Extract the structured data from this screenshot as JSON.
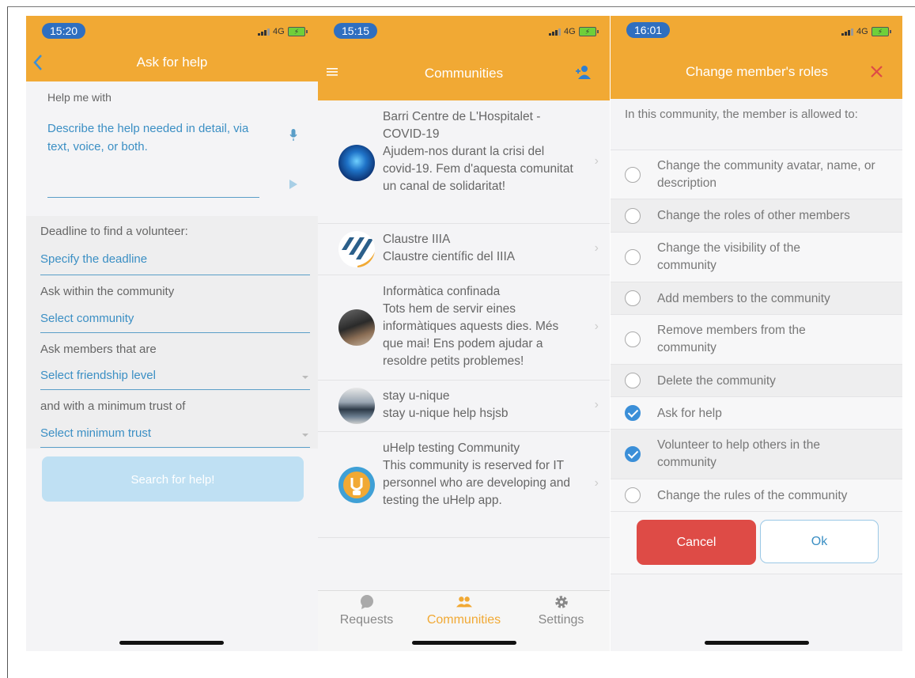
{
  "phone1": {
    "time": "15:20",
    "network": "4G",
    "title": "Ask for help",
    "help_label": "Help me with",
    "help_placeholder": "Describe the help needed in detail, via text, voice, or both.",
    "deadline_label": "Deadline to find a volunteer:",
    "deadline_value": "Specify the deadline",
    "community_label": "Ask within the community",
    "community_value": "Select community",
    "friendship_label": "Ask members that are",
    "friendship_value": "Select friendship level",
    "trust_label": "and with a minimum trust of",
    "trust_value": "Select minimum trust",
    "search_button": "Search for help!"
  },
  "phone2": {
    "time": "15:15",
    "network": "4G",
    "title": "Communities",
    "communities": [
      {
        "name": "Barri Centre de L'Hospitalet - COVID-19",
        "description": "Ajudem-nos durant la crisi del covid-19. Fem d'aquesta comunitat un canal de solidaritat!"
      },
      {
        "name": "Claustre IIIA",
        "description": "Claustre científic del IIIA"
      },
      {
        "name": "Informàtica confinada",
        "description": "Tots hem de servir eines informàtiques aquests dies. Més que mai! Ens podem ajudar a resoldre petits problemes!"
      },
      {
        "name": "stay u-nique",
        "description": "stay u-nique help hsjsb"
      },
      {
        "name": "uHelp testing Community",
        "description": "This community is reserved for IT personnel who are developing and testing the uHelp app."
      }
    ],
    "tabs": {
      "requests": "Requests",
      "communities": "Communities",
      "settings": "Settings"
    }
  },
  "phone3": {
    "time": "16:01",
    "network": "4G",
    "title": "Change member's roles",
    "intro": "In this community, the member is allowed to:",
    "options": [
      {
        "label": "Change the community avatar, name, or description",
        "checked": false
      },
      {
        "label": "Change the roles of other members",
        "checked": false
      },
      {
        "label": "Change the visibility of the community",
        "checked": false
      },
      {
        "label": "Add members to the community",
        "checked": false
      },
      {
        "label": "Remove members from the community",
        "checked": false
      },
      {
        "label": "Delete the community",
        "checked": false
      },
      {
        "label": "Ask for help",
        "checked": true
      },
      {
        "label": "Volunteer to help others in the community",
        "checked": true
      },
      {
        "label": "Change the rules of the community",
        "checked": false
      }
    ],
    "cancel": "Cancel",
    "ok": "Ok"
  },
  "colors": {
    "header": "#f1a934",
    "link": "#3b8fc4",
    "cancel": "#de4b46",
    "check": "#3b8fd8"
  }
}
